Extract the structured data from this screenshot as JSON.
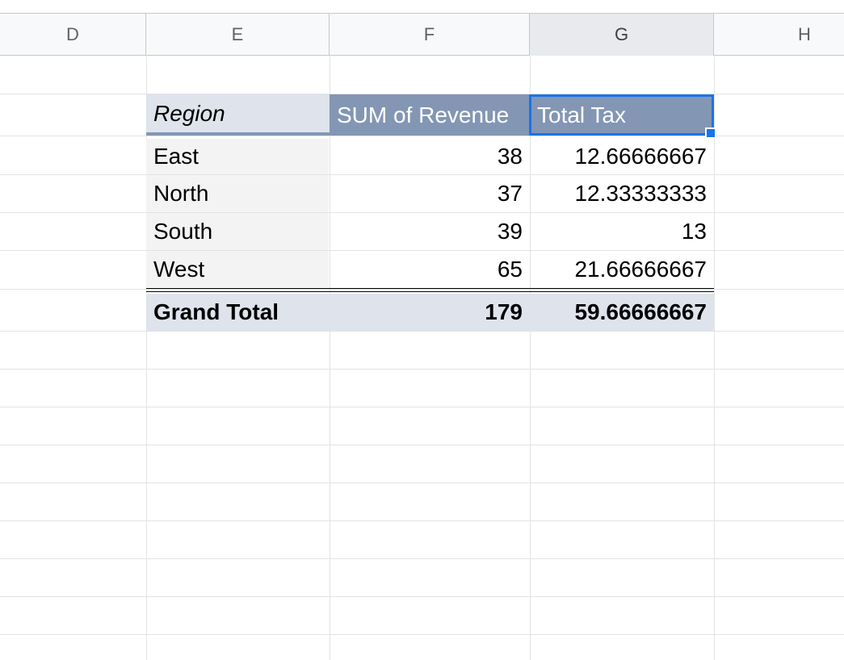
{
  "columns": [
    "D",
    "E",
    "F",
    "G",
    "H"
  ],
  "selected_column": "G",
  "pivot": {
    "headers": {
      "region": "Region",
      "revenue": "SUM of Revenue",
      "tax": "Total Tax"
    },
    "rows": [
      {
        "region": "East",
        "revenue": "38",
        "tax": "12.66666667"
      },
      {
        "region": "North",
        "revenue": "37",
        "tax": "12.33333333"
      },
      {
        "region": "South",
        "revenue": "39",
        "tax": "13"
      },
      {
        "region": "West",
        "revenue": "65",
        "tax": "21.66666667"
      }
    ],
    "total": {
      "label": "Grand Total",
      "revenue": "179",
      "tax": "59.66666667"
    }
  },
  "colors": {
    "header_accent": "#8396b4",
    "header_light": "#dfe3ec",
    "selection": "#1a73e8"
  }
}
